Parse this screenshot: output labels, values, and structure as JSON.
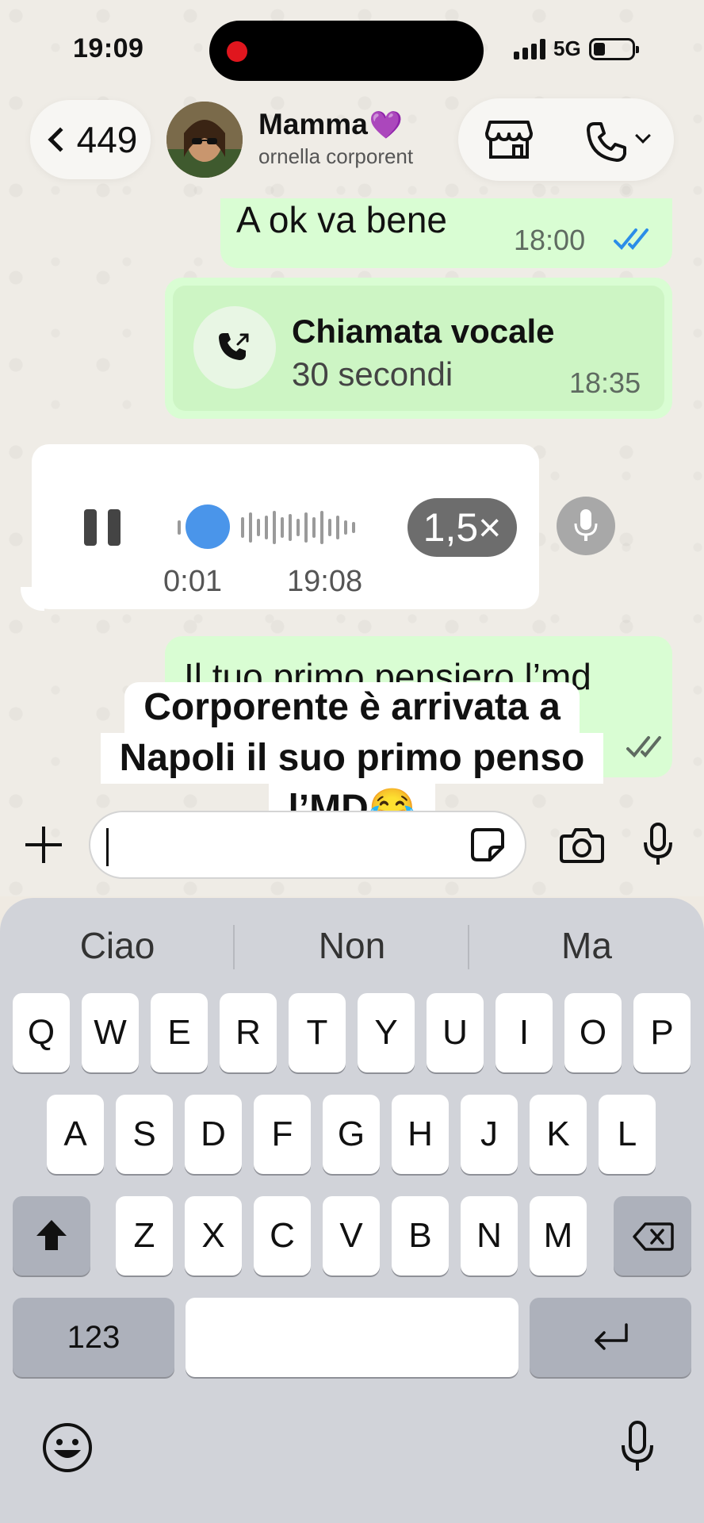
{
  "status_bar": {
    "time": "19:09",
    "network": "5G"
  },
  "header": {
    "back_count": "449",
    "contact_name": "Mamma",
    "contact_emoji": "💜",
    "contact_subtitle": "ornella corporent",
    "icons": [
      "shop-icon",
      "phone-icon",
      "chevron-down-icon"
    ]
  },
  "messages": [
    {
      "type": "text",
      "direction": "out",
      "text": "A ok va bene",
      "time": "18:00",
      "status": "read"
    },
    {
      "type": "call",
      "direction": "out",
      "title": "Chiamata vocale",
      "subtitle": "30 secondi",
      "time": "18:35"
    },
    {
      "type": "audio",
      "direction": "in",
      "elapsed": "0:01",
      "time": "19:08",
      "speed": "1,5×",
      "progress": 0.05
    },
    {
      "type": "text",
      "direction": "out",
      "text": "Il tuo primo pensiero l’md",
      "status": "delivered"
    }
  ],
  "caption": {
    "line1": "Corporente è arrivata a",
    "line2": "Napoli il suo primo penso",
    "line3": "l’MD😂"
  },
  "composer": {
    "placeholder": ""
  },
  "keyboard": {
    "suggestions": [
      "Ciao",
      "Non",
      "Ma"
    ],
    "row1": [
      "Q",
      "W",
      "E",
      "R",
      "T",
      "Y",
      "U",
      "I",
      "O",
      "P"
    ],
    "row2": [
      "A",
      "S",
      "D",
      "F",
      "G",
      "H",
      "J",
      "K",
      "L"
    ],
    "row3": [
      "Z",
      "X",
      "C",
      "V",
      "B",
      "N",
      "M"
    ],
    "numbers_key": "123"
  }
}
